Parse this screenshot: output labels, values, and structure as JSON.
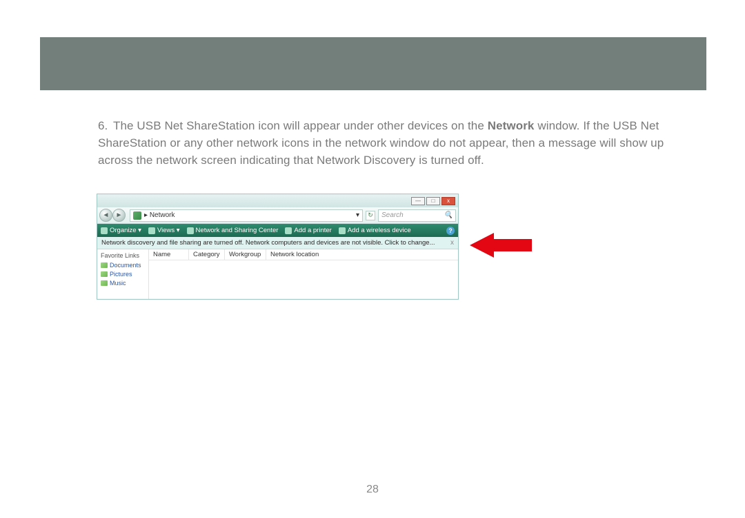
{
  "instruction": {
    "number": "6.",
    "text_part1": "The USB Net ShareStation icon will appear under other devices on the ",
    "bold_word": "Network",
    "text_part2": " window. If the USB Net ShareStation or any other network icons in the network window do not appear, then a message will show up across the network screen indicating that Network Discovery is turned off."
  },
  "window": {
    "title_buttons": {
      "min": "—",
      "max": "□",
      "close": "x"
    },
    "breadcrumb": {
      "arrow": "▸",
      "label": "Network",
      "dropdown": "▾"
    },
    "refresh": "↻",
    "search_placeholder": "Search",
    "toolbar": {
      "organize": "Organize ▾",
      "views": "Views ▾",
      "sharing_center": "Network and Sharing Center",
      "add_printer": "Add a printer",
      "add_wireless": "Add a wireless device",
      "help": "?"
    },
    "notification": "Network discovery and file sharing are turned off. Network computers and devices are not visible. Click to change...",
    "notification_close": "x",
    "sidebar": {
      "header": "Favorite Links",
      "links": [
        "Documents",
        "Pictures",
        "Music"
      ]
    },
    "columns": [
      "Name",
      "Category",
      "Workgroup",
      "Network location"
    ]
  },
  "page_number": "28"
}
